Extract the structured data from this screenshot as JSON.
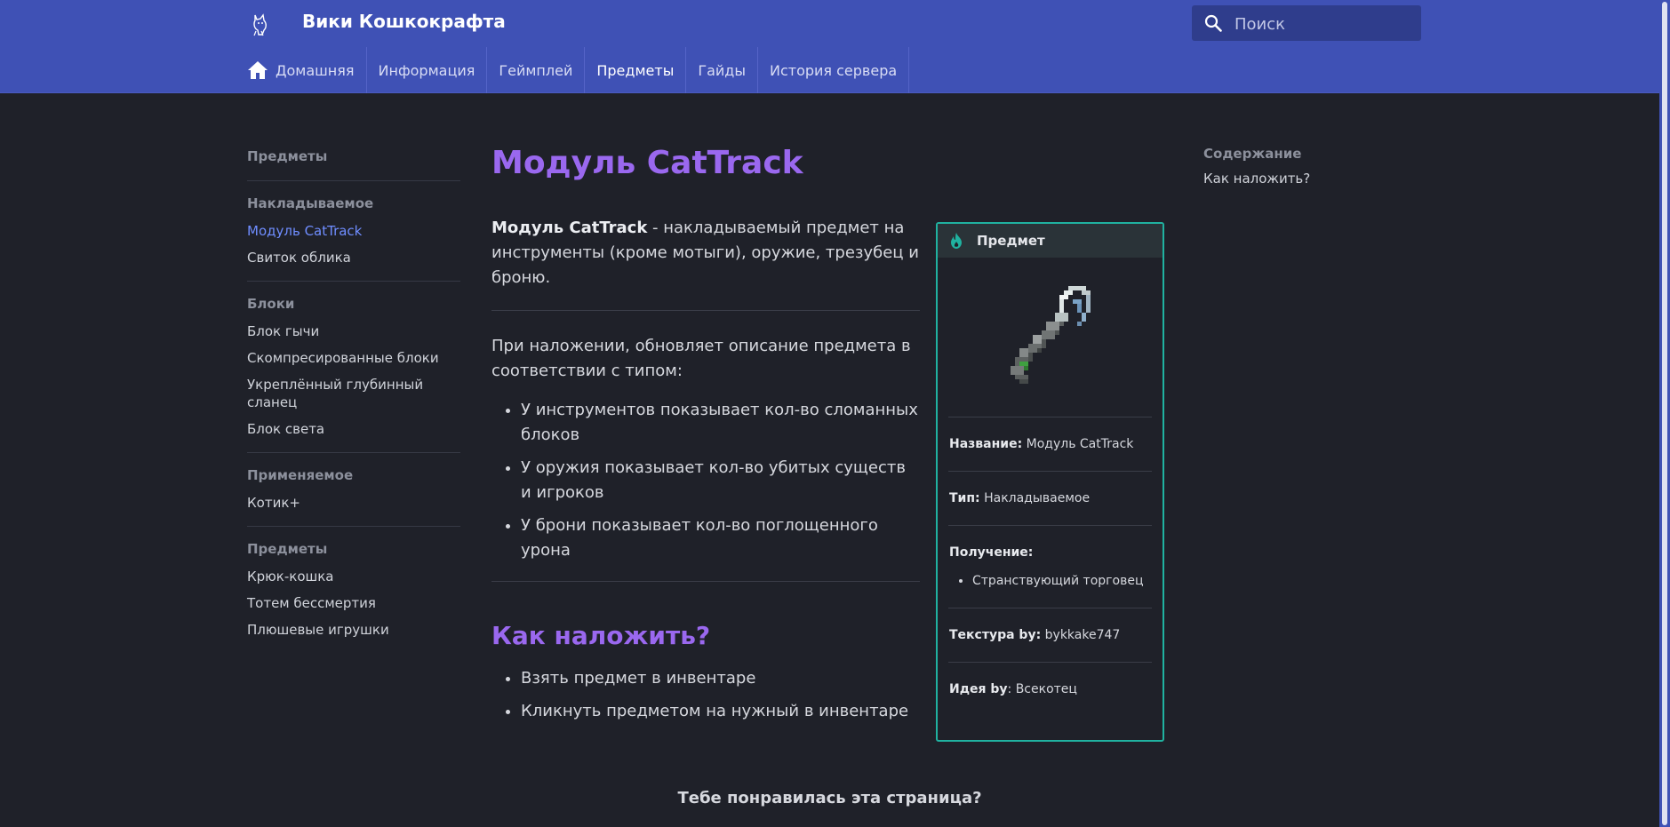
{
  "header": {
    "site_title": "Вики Кошкокрафта",
    "search_placeholder": "Поиск",
    "brand_color": "#3f51b5"
  },
  "tabs": [
    {
      "label": "Домашняя",
      "icon": "home-icon"
    },
    {
      "label": "Информация"
    },
    {
      "label": "Геймплей"
    },
    {
      "label": "Предметы",
      "active": true
    },
    {
      "label": "Гайды"
    },
    {
      "label": "История сервера"
    }
  ],
  "leftnav": {
    "title": "Предметы",
    "sections": [
      {
        "heading": "Накладываемое",
        "items": [
          "Модуль CatTrack",
          "Свиток облика"
        ]
      },
      {
        "heading": "Блоки",
        "items": [
          "Блок гычи",
          "Скомпресированные блоки",
          "Укреплённый глубинный сланец",
          "Блок света"
        ]
      },
      {
        "heading": "Применяемое",
        "items": [
          "Котик+"
        ]
      },
      {
        "heading": "Предметы",
        "items": [
          "Крюк-кошка",
          "Тотем бессмертия",
          "Плюшевые игрушки"
        ]
      }
    ]
  },
  "main": {
    "title": "Модуль CatTrack",
    "intro_bold": "Модуль CatTrack",
    "intro_rest": " - накладываемый предмет на инструменты (кроме мотыги), оружие, трезубец и броню.",
    "para2": "При наложении, обновляет описание предмета в соответствии с типом:",
    "bullets": [
      "У инструментов показывает кол-во сломанных блоков",
      "У оружия показывает кол-во убитых существ и игроков",
      "У брони показывает кол-во поглощенного урона"
    ],
    "h2": "Как наложить?",
    "steps": [
      "Взять предмет в инвентаре",
      "Кликнуть предметом на нужный в инвентаре"
    ]
  },
  "infobox": {
    "header": "Предмет",
    "name_label": "Название:",
    "name_value": "Модуль CatTrack",
    "type_label": "Тип:",
    "type_value": "Накладываемое",
    "obtain_label": "Получение:",
    "obtain_items": [
      "Странствующий торговец"
    ],
    "texture_label": "Текстура by:",
    "texture_value": "bykkake747",
    "idea_label": "Идея by",
    "idea_value": ": Всекотец",
    "accent_color": "#20b2a0"
  },
  "toc": {
    "heading": "Содержание",
    "items": [
      "Как наложить?"
    ]
  },
  "feedback": "Тебе понравилась эта страница?"
}
